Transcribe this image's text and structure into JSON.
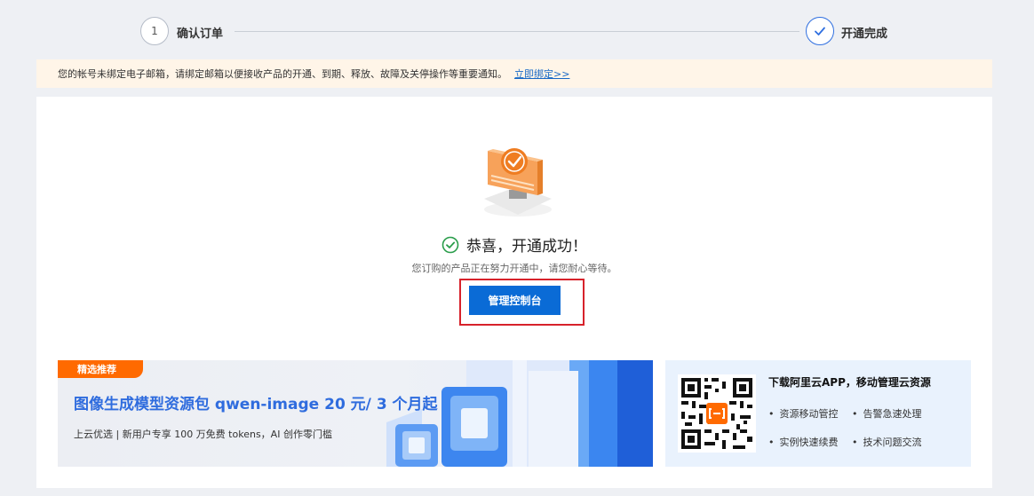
{
  "steps": [
    {
      "number": "1",
      "label": "确认订单"
    },
    {
      "label": "开通完成"
    }
  ],
  "notice": {
    "text": "您的帐号未绑定电子邮箱，请绑定邮箱以便接收产品的开通、到期、释放、故障及关停操作等重要通知。",
    "link": "立即绑定>>"
  },
  "result": {
    "title": "恭喜，开通成功！",
    "subtitle": "您订购的产品正在努力开通中，请您耐心等待。",
    "button": "管理控制台"
  },
  "promo": {
    "tag": "精选推荐",
    "title": "图像生成模型资源包 qwen-image 20 元/ 3 个月起",
    "desc": "上云优选 | 新用户专享 100 万免费 tokens，AI 创作零门槛"
  },
  "app": {
    "title": "下载阿里云APP，移动管理云资源",
    "features": [
      "资源移动管控",
      "告警急速处理",
      "实例快速续费",
      "技术问题交流"
    ]
  },
  "colors": {
    "primary": "#0a6bd6",
    "accent_orange": "#ff6a00",
    "success_green": "#2a9d4b",
    "highlight_red": "#d7222b"
  }
}
